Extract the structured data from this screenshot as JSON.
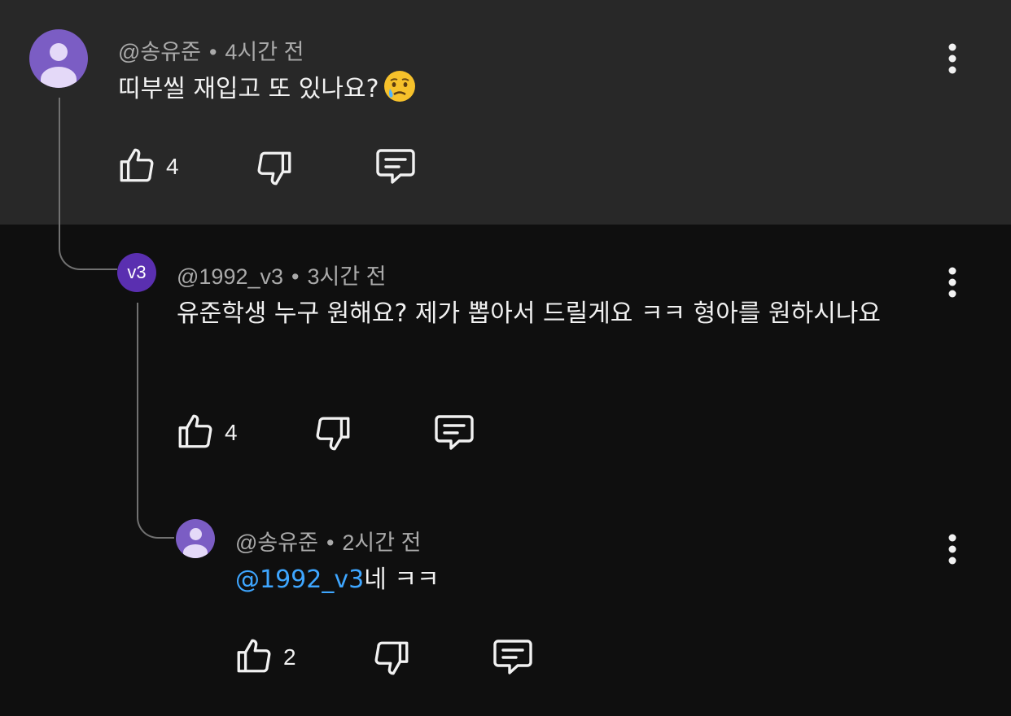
{
  "comments": [
    {
      "author": "@송유준",
      "time": "4시간 전",
      "text": "띠부씰 재입고 또 있나요?",
      "emoji": "😢",
      "likes": "4"
    },
    {
      "author": "@1992_v3",
      "avatar_text": "v3",
      "time": "3시간 전",
      "text": "유준학생 누구 원해요? 제가 뽑아서 드릴게요 ㅋㅋ 형아를 원하시나요",
      "likes": "4"
    },
    {
      "author": "@송유준",
      "time": "2시간 전",
      "mention": "@1992_v3",
      "text": "네 ㅋㅋ",
      "likes": "2"
    }
  ],
  "separator": "•",
  "icons": [
    "like-icon",
    "dislike-icon",
    "reply-icon",
    "more-vert-icon",
    "crying-face-emoji"
  ],
  "colors": {
    "highlight_bg": "#282828",
    "page_bg": "#0f0f0f",
    "mention": "#3ea6ff",
    "avatar_purple": "#7b5dc4",
    "avatar_v3": "#5a2fb0"
  }
}
